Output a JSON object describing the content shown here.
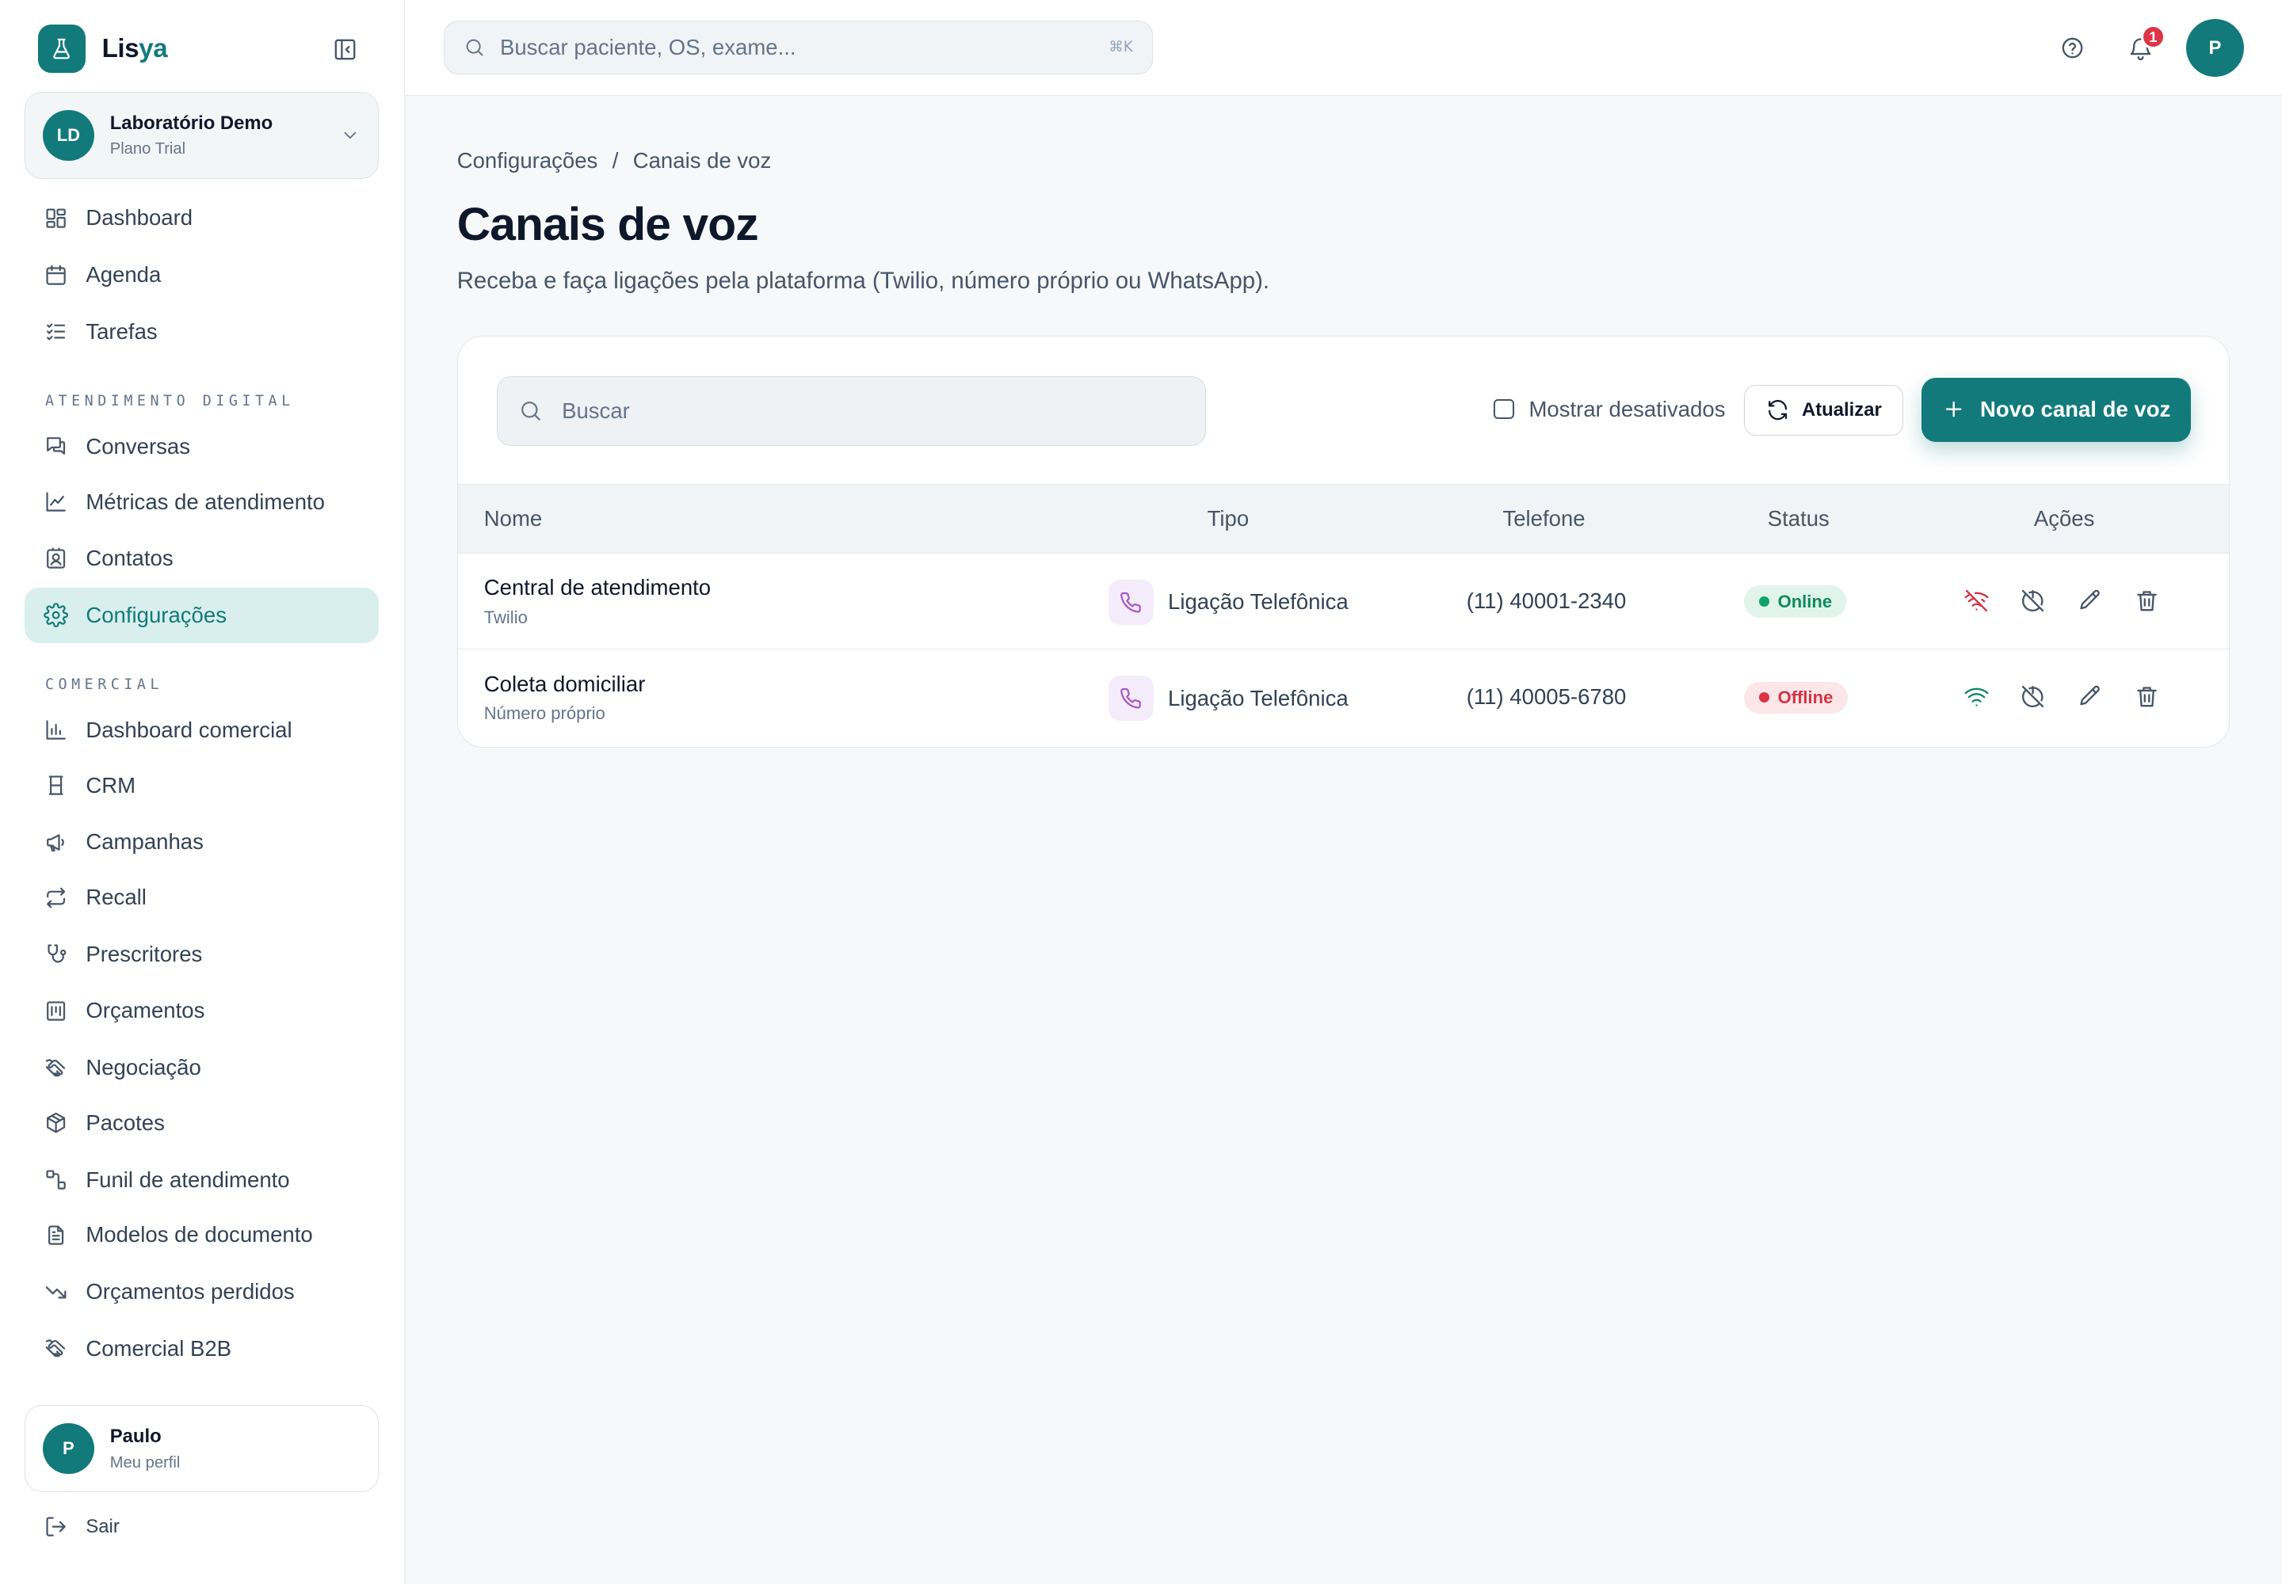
{
  "brand": {
    "name_main": "Lis",
    "name_accent": "ya"
  },
  "organization": {
    "initials": "LD",
    "name": "Laboratório Demo",
    "plan": "Plano Trial"
  },
  "nav": {
    "main": [
      {
        "label": "Dashboard",
        "icon": "dashboard-icon"
      },
      {
        "label": "Agenda",
        "icon": "calendar-icon"
      },
      {
        "label": "Tarefas",
        "icon": "tasks-icon"
      }
    ],
    "section_digital": "ATENDIMENTO DIGITAL",
    "digital": [
      {
        "label": "Conversas",
        "icon": "chat-icon"
      },
      {
        "label": "Métricas de atendimento",
        "icon": "line-chart-icon"
      },
      {
        "label": "Contatos",
        "icon": "contacts-icon"
      },
      {
        "label": "Configurações",
        "icon": "gear-icon",
        "active": true
      }
    ],
    "section_comercial": "COMERCIAL",
    "comercial": [
      {
        "label": "Dashboard comercial",
        "icon": "bar-chart-icon"
      },
      {
        "label": "CRM",
        "icon": "crm-icon"
      },
      {
        "label": "Campanhas",
        "icon": "megaphone-icon"
      },
      {
        "label": "Recall",
        "icon": "arrows-icon"
      },
      {
        "label": "Prescritores",
        "icon": "stethoscope-icon"
      },
      {
        "label": "Orçamentos",
        "icon": "receipt-icon"
      },
      {
        "label": "Negociação",
        "icon": "handshake-icon"
      },
      {
        "label": "Pacotes",
        "icon": "package-icon"
      },
      {
        "label": "Funil de atendimento",
        "icon": "funnel-icon"
      },
      {
        "label": "Modelos de documento",
        "icon": "document-icon"
      },
      {
        "label": "Orçamentos perdidos",
        "icon": "trending-down-icon"
      },
      {
        "label": "Comercial B2B",
        "icon": "handshake-icon"
      }
    ]
  },
  "user": {
    "initial": "P",
    "name": "Paulo",
    "subtitle": "Meu perfil"
  },
  "logout_label": "Sair",
  "topbar": {
    "search_placeholder": "Buscar paciente, OS, exame...",
    "search_shortcut": "⌘K",
    "notification_count": "1",
    "avatar_initial": "P"
  },
  "breadcrumb": {
    "parent": "Configurações",
    "separator": "/",
    "current": "Canais de voz"
  },
  "page": {
    "title": "Canais de voz",
    "description": "Receba e faça ligações pela plataforma (Twilio, número próprio ou WhatsApp)."
  },
  "toolbar": {
    "search_placeholder": "Buscar",
    "show_disabled_label": "Mostrar desativados",
    "show_disabled_checked": false,
    "refresh_label": "Atualizar",
    "new_label": "Novo canal de voz"
  },
  "table": {
    "headers": {
      "name": "Nome",
      "type": "Tipo",
      "phone": "Telefone",
      "status": "Status",
      "actions": "Ações"
    },
    "rows": [
      {
        "name": "Central de atendimento",
        "provider": "Twilio",
        "type": "Ligação Telefônica",
        "phone": "(11) 40001-2340",
        "status": "Online",
        "status_color": "#10a36b",
        "connection_icon": "wifi-off-icon"
      },
      {
        "name": "Coleta domiciliar",
        "provider": "Número próprio",
        "type": "Ligação Telefônica",
        "phone": "(11) 40005-6780",
        "status": "Offline",
        "status_color": "#dc3545",
        "connection_icon": "wifi-icon"
      }
    ]
  },
  "colors": {
    "brand": "#127a7a",
    "active_bg": "#d9efed",
    "online": "#10a36b",
    "offline": "#dc3545",
    "type_icon": "#a855c7"
  }
}
